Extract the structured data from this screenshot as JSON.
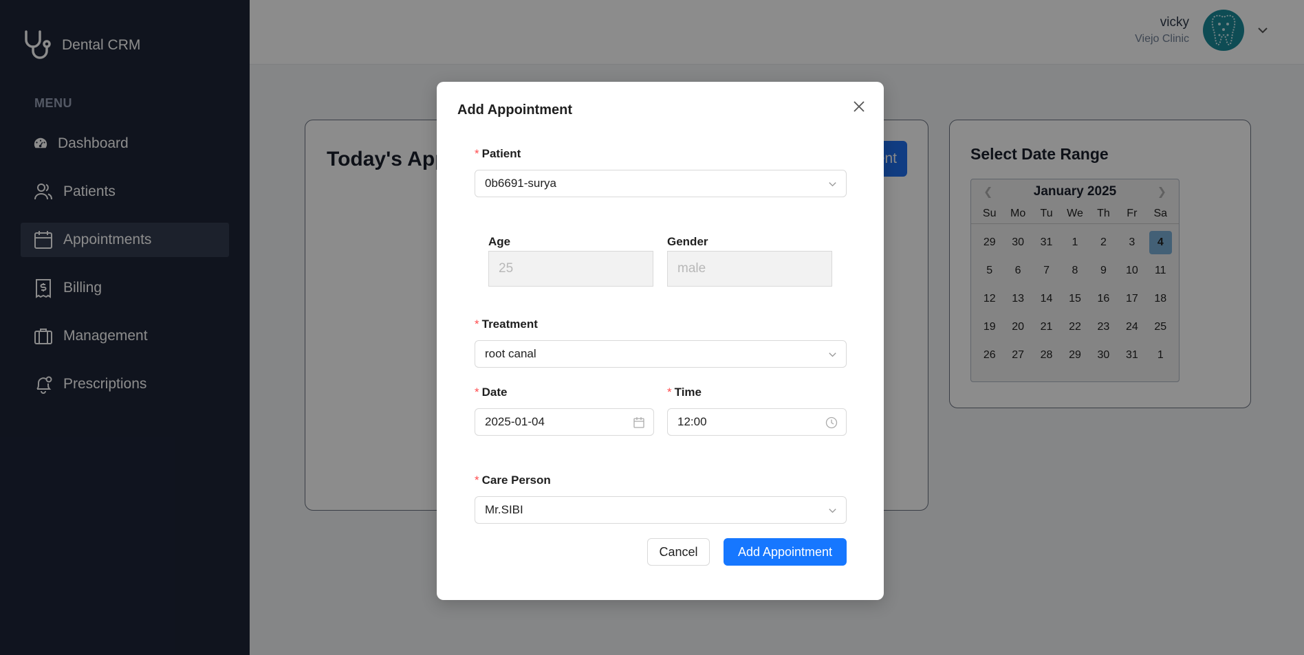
{
  "brand": {
    "name": "Dental CRM",
    "icon": "stethoscope-icon"
  },
  "menu": {
    "title": "MENU",
    "items": [
      {
        "label": "Dashboard",
        "icon": "gauge-icon",
        "active": false
      },
      {
        "label": "Patients",
        "icon": "users-icon",
        "active": false
      },
      {
        "label": "Appointments",
        "icon": "calendar-icon",
        "active": true
      },
      {
        "label": "Billing",
        "icon": "receipt-dollar-icon",
        "active": false
      },
      {
        "label": "Management",
        "icon": "briefcase-icon",
        "active": false
      },
      {
        "label": "Prescriptions",
        "icon": "bell-icon",
        "active": false
      }
    ]
  },
  "header": {
    "user_name": "vicky",
    "clinic": "Viejo Clinic",
    "theme_toggle": "light"
  },
  "appointments_card": {
    "title": "Today's Appointments",
    "add_button": "Add Appointment"
  },
  "date_range": {
    "title": "Select Date Range",
    "month": "January 2025",
    "days_of_week": [
      "Su",
      "Mo",
      "Tu",
      "We",
      "Th",
      "Fr",
      "Sa"
    ],
    "days": [
      "29",
      "30",
      "31",
      "1",
      "2",
      "3",
      "4",
      "5",
      "6",
      "7",
      "8",
      "9",
      "10",
      "11",
      "12",
      "13",
      "14",
      "15",
      "16",
      "17",
      "18",
      "19",
      "20",
      "21",
      "22",
      "23",
      "24",
      "25",
      "26",
      "27",
      "28",
      "29",
      "30",
      "31",
      "1"
    ],
    "selected": "4"
  },
  "modal": {
    "title": "Add Appointment",
    "patient_label": "Patient",
    "patient_value": "0b6691-surya",
    "age_label": "Age",
    "age_value": "25",
    "gender_label": "Gender",
    "gender_value": "male",
    "treatment_label": "Treatment",
    "treatment_value": "root canal",
    "date_label": "Date",
    "date_value": "2025-01-04",
    "time_label": "Time",
    "time_value": "12:00",
    "care_label": "Care Person",
    "care_value": "Mr.SIBI",
    "cancel_label": "Cancel",
    "submit_label": "Add Appointment"
  },
  "colors": {
    "sidebar_bg": "#1e2538",
    "primary": "#1677ff",
    "required": "#ff4d4f"
  }
}
